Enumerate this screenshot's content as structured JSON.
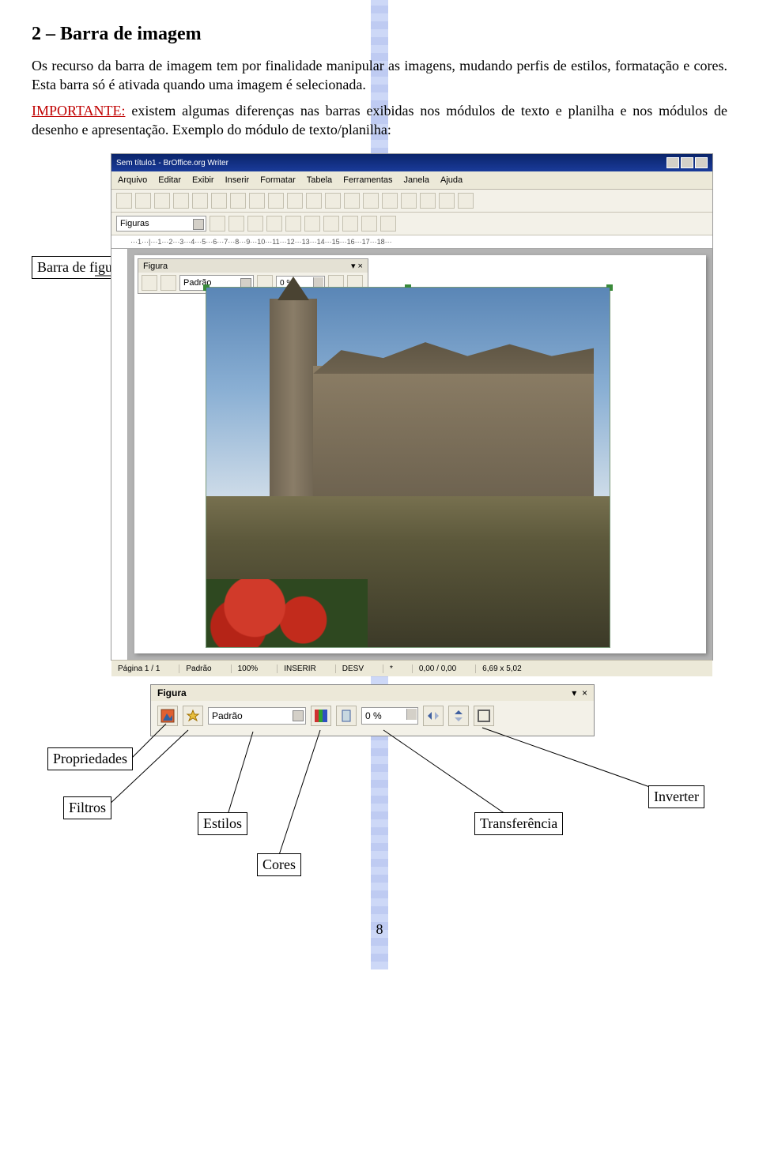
{
  "heading": "2 – Barra de imagem",
  "paragraph1": "Os recurso da barra de imagem tem por finalidade manipular as imagens, mudando perfis de estilos, formatação e cores. Esta barra só é ativada quando uma imagem é selecionada.",
  "important_label": "IMPORTANTE:",
  "paragraph2": " existem algumas diferenças nas barras exibidas nos módulos de texto e planilha e nos módulos de desenho e apresentação. Exemplo do módulo de texto/planilha:",
  "callout_barra": "Barra de figura",
  "callout_propriedades": "Propriedades",
  "callout_filtros": "Filtros",
  "callout_estilos": "Estilos",
  "callout_cores": "Cores",
  "callout_transferencia": "Transferência",
  "callout_inverter": "Inverter",
  "pagenum": "8",
  "app": {
    "title": "Sem título1 - BrOffice.org Writer",
    "menus": [
      "Arquivo",
      "Editar",
      "Exibir",
      "Inserir",
      "Formatar",
      "Tabela",
      "Ferramentas",
      "Janela",
      "Ajuda"
    ],
    "style_selector": "Figuras",
    "ruler": "···1···|···1···2···3···4···5···6···7···8···9···10···11···12···13···14···15···16···17···18···",
    "fig_title": "Figura",
    "fig_style": "Padrão",
    "fig_transp": "0 %",
    "status": {
      "page": "Página 1 / 1",
      "style": "Padrão",
      "zoom": "100%",
      "ins": "INSERIR",
      "desv": "DESV",
      "star": "*",
      "coord1": "0,00 / 0,00",
      "coord2": "6,69 x 5,02"
    }
  },
  "figbar2": {
    "title": "Figura",
    "style": "Padrão",
    "transp": "0 %"
  }
}
